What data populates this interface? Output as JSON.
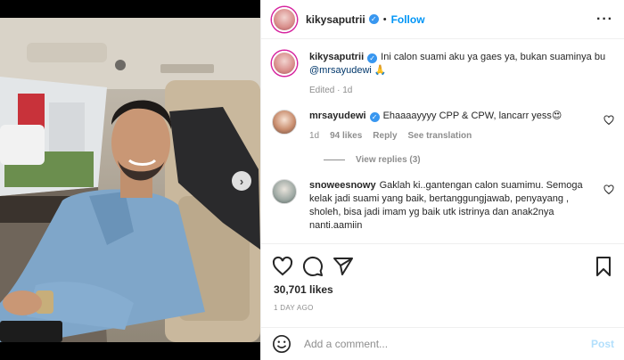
{
  "post": {
    "author": {
      "username": "kikysaputrii",
      "follow_label": "Follow",
      "separator": "•"
    },
    "caption": {
      "username": "kikysaputrii",
      "text": "Ini calon suami aku ya gaes ya, bukan suaminya bu ",
      "mention": "@mrsayudewi",
      "suffix": " 🙏",
      "meta": "Edited · 1d"
    },
    "comments": [
      {
        "username": "mrsayudewi",
        "text": "Ehaaaayyyy CPP & CPW, lancarr yess😍",
        "time": "1d",
        "likes": "94 likes",
        "reply_label": "Reply",
        "translate_label": "See translation",
        "view_replies": "View replies (3)"
      },
      {
        "username": "snoweesnowy",
        "text": "Gaklah ki..gantengan calon suamimu. Semoga kelak jadi suami yang baik, bertanggungjawab, penyayang , sholeh, bisa jadi imam yg baik utk istrinya dan anak2nya nanti.aamiin"
      }
    ],
    "likes_count": "30,701 likes",
    "date": "1 DAY AGO",
    "add_comment": {
      "placeholder": "Add a comment...",
      "post_label": "Post"
    }
  },
  "colors": {
    "accent": "#0095f6",
    "verified": "#3897f0",
    "muted": "#8e8e8e",
    "text": "#262626",
    "post_disabled": "#b2dffc"
  },
  "icons": [
    "verified-badge-icon",
    "more-options-icon",
    "heart-icon",
    "comment-icon",
    "share-icon",
    "bookmark-icon",
    "emoji-icon",
    "next-arrow-icon"
  ]
}
